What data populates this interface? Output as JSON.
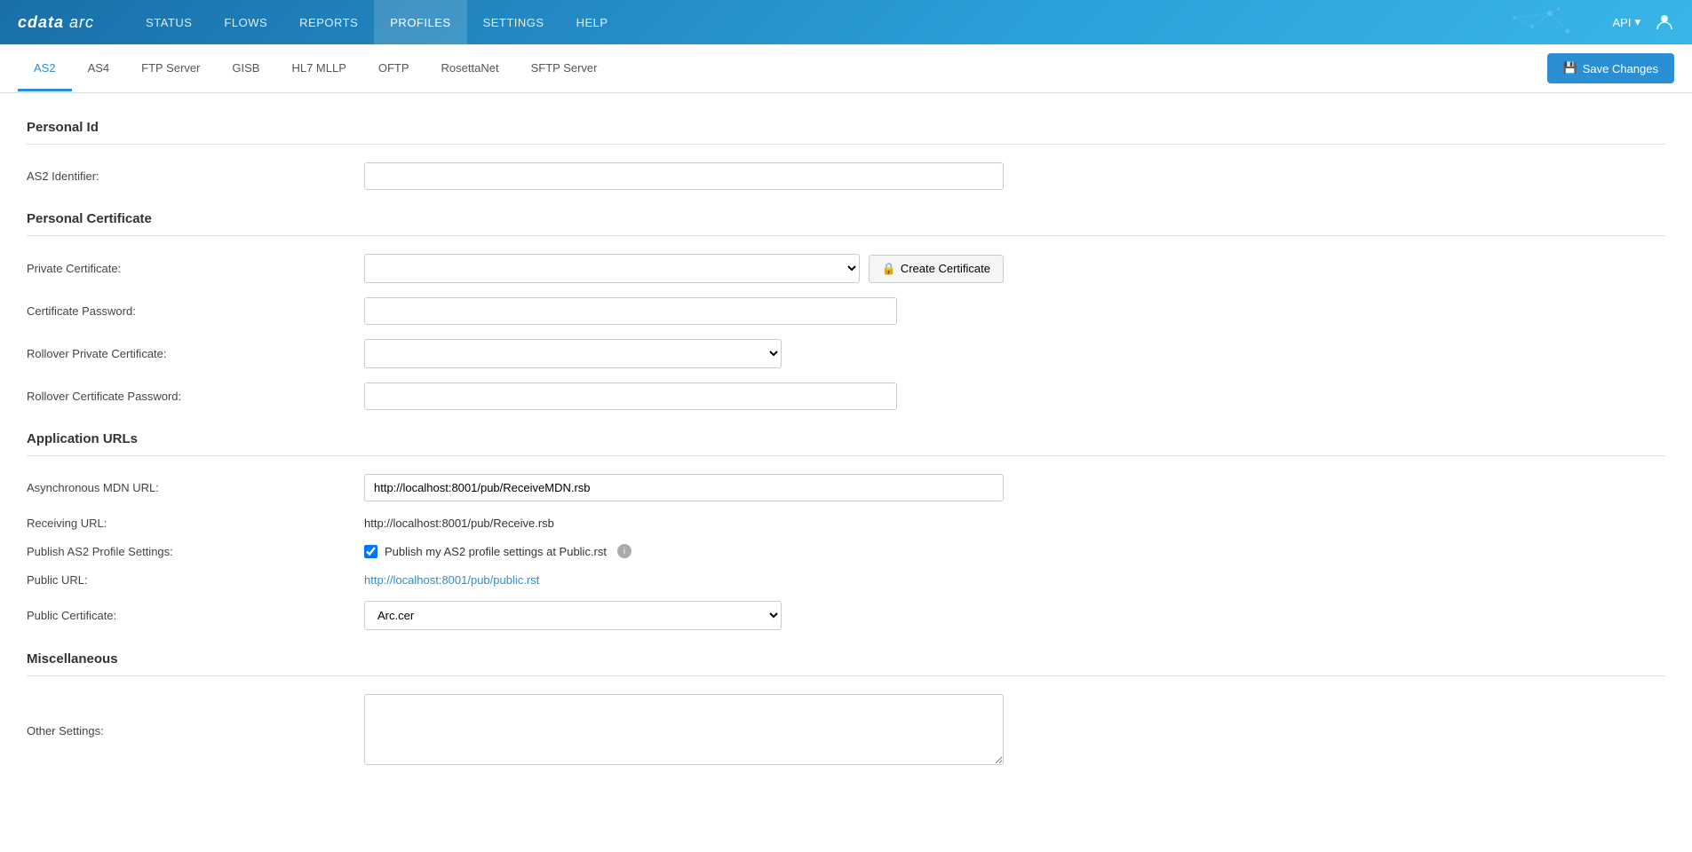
{
  "brand": {
    "name": "cdata",
    "sub": "arc"
  },
  "navbar": {
    "links": [
      {
        "label": "STATUS",
        "active": false
      },
      {
        "label": "FLOWS",
        "active": false
      },
      {
        "label": "REPORTS",
        "active": false
      },
      {
        "label": "PROFILES",
        "active": true
      },
      {
        "label": "SETTINGS",
        "active": false
      },
      {
        "label": "HELP",
        "active": false
      }
    ],
    "api_label": "API",
    "user_icon": "👤"
  },
  "tabs": [
    {
      "label": "AS2",
      "active": true
    },
    {
      "label": "AS4",
      "active": false
    },
    {
      "label": "FTP Server",
      "active": false
    },
    {
      "label": "GISB",
      "active": false
    },
    {
      "label": "HL7 MLLP",
      "active": false
    },
    {
      "label": "OFTP",
      "active": false
    },
    {
      "label": "RosettaNet",
      "active": false
    },
    {
      "label": "SFTP Server",
      "active": false
    }
  ],
  "save_button": "Save Changes",
  "sections": {
    "personal_id": {
      "title": "Personal Id",
      "fields": [
        {
          "label": "AS2 Identifier:",
          "type": "text",
          "value": "",
          "placeholder": ""
        }
      ]
    },
    "personal_certificate": {
      "title": "Personal Certificate",
      "fields": [
        {
          "label": "Private Certificate:",
          "type": "select",
          "value": "",
          "options": [
            ""
          ]
        },
        {
          "label": "Certificate Password:",
          "type": "password",
          "value": ""
        },
        {
          "label": "Rollover Private Certificate:",
          "type": "select",
          "value": "",
          "options": [
            ""
          ]
        },
        {
          "label": "Rollover Certificate Password:",
          "type": "password",
          "value": ""
        }
      ],
      "create_cert_label": "Create Certificate"
    },
    "application_urls": {
      "title": "Application URLs",
      "fields": [
        {
          "label": "Asynchronous MDN URL:",
          "type": "text",
          "value": "http://localhost:8001/pub/ReceiveMDN.rsb"
        },
        {
          "label": "Receiving URL:",
          "type": "static",
          "value": "http://localhost:8001/pub/Receive.rsb"
        },
        {
          "label": "Publish AS2 Profile Settings:",
          "type": "checkbox",
          "checked": true,
          "checkbox_label": "Publish my AS2 profile settings at Public.rst"
        },
        {
          "label": "Public URL:",
          "type": "link",
          "value": "http://localhost:8001/pub/public.rst"
        },
        {
          "label": "Public Certificate:",
          "type": "select",
          "value": "Arc.cer",
          "options": [
            "Arc.cer"
          ]
        }
      ]
    },
    "miscellaneous": {
      "title": "Miscellaneous",
      "fields": [
        {
          "label": "Other Settings:",
          "type": "textarea",
          "value": ""
        }
      ]
    }
  }
}
